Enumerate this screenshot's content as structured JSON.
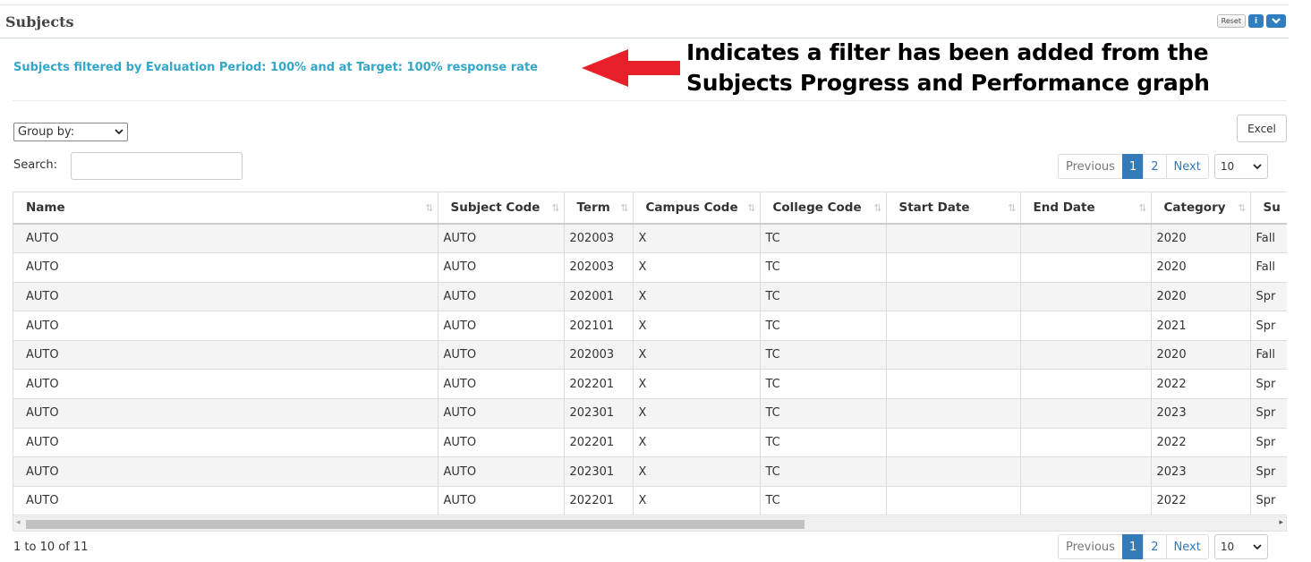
{
  "panel": {
    "title": "Subjects",
    "reset_label": "Reset",
    "info_label": "i",
    "collapse_icon": "chevron-down-icon"
  },
  "filter_notice": "Subjects filtered by Evaluation Period: 100% and at Target: 100% response rate",
  "annotation": {
    "line1": "Indicates a filter has been added from the",
    "line2": "Subjects Progress and Performance graph",
    "arrow_color": "#e8202a"
  },
  "controls": {
    "group_by_label": "Group by:",
    "excel_label": "Excel",
    "search_label": "Search:",
    "search_value": ""
  },
  "pagination": {
    "previous": "Previous",
    "pages": [
      "1",
      "2"
    ],
    "next": "Next",
    "page_length": "10",
    "active_page": "1"
  },
  "table": {
    "columns": [
      "Name",
      "Subject Code",
      "Term",
      "Campus Code",
      "College Code",
      "Start Date",
      "End Date",
      "Category",
      "Su"
    ],
    "rows": [
      [
        "AUTO",
        "AUTO",
        "202003",
        "X",
        "TC",
        "",
        "",
        "2020",
        "Fall"
      ],
      [
        "AUTO",
        "AUTO",
        "202003",
        "X",
        "TC",
        "",
        "",
        "2020",
        "Fall"
      ],
      [
        "AUTO",
        "AUTO",
        "202001",
        "X",
        "TC",
        "",
        "",
        "2020",
        "Spr"
      ],
      [
        "AUTO",
        "AUTO",
        "202101",
        "X",
        "TC",
        "",
        "",
        "2021",
        "Spr"
      ],
      [
        "AUTO",
        "AUTO",
        "202003",
        "X",
        "TC",
        "",
        "",
        "2020",
        "Fall"
      ],
      [
        "AUTO",
        "AUTO",
        "202201",
        "X",
        "TC",
        "",
        "",
        "2022",
        "Spr"
      ],
      [
        "AUTO",
        "AUTO",
        "202301",
        "X",
        "TC",
        "",
        "",
        "2023",
        "Spr"
      ],
      [
        "AUTO",
        "AUTO",
        "202201",
        "X",
        "TC",
        "",
        "",
        "2022",
        "Spr"
      ],
      [
        "AUTO",
        "AUTO",
        "202301",
        "X",
        "TC",
        "",
        "",
        "2023",
        "Spr"
      ],
      [
        "AUTO",
        "AUTO",
        "202201",
        "X",
        "TC",
        "",
        "",
        "2022",
        "Spr"
      ]
    ]
  },
  "footer": {
    "info": "1 to 10 of 11"
  },
  "colors": {
    "accent": "#337ab7",
    "filter_text": "#34a6c8",
    "arrow": "#e8202a"
  }
}
